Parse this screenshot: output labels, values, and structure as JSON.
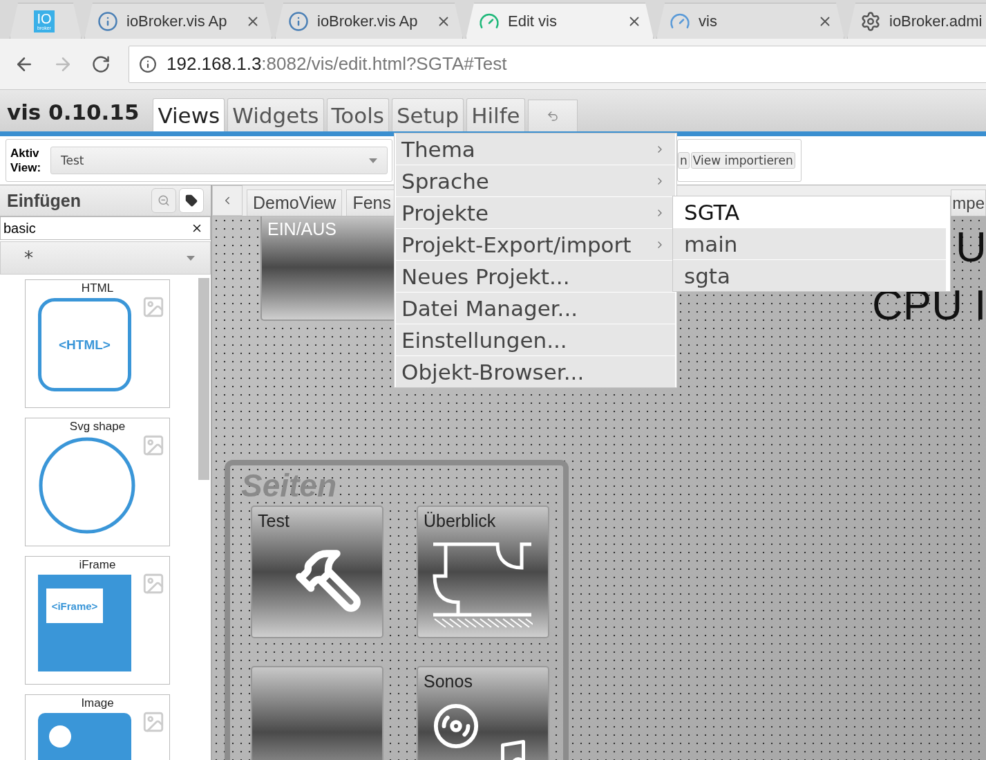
{
  "browser": {
    "tabs": [
      {
        "kind": "logo",
        "logo_text": "IO",
        "logo_subtext": "broker",
        "selected": false
      },
      {
        "kind": "info",
        "title": "ioBroker.vis Ap",
        "selected": false
      },
      {
        "kind": "info",
        "title": "ioBroker.vis Ap",
        "selected": false
      },
      {
        "kind": "dash",
        "title": "Edit vis",
        "selected": true
      },
      {
        "kind": "gauge",
        "title": "vis",
        "selected": false
      },
      {
        "kind": "gear",
        "title": "ioBroker.admi",
        "selected": false
      }
    ],
    "address": {
      "host": "192.168.1.3",
      "path": ":8082/vis/edit.html?SGTA#Test"
    }
  },
  "app": {
    "title": "vis 0.10.15",
    "tabs": [
      {
        "label": "Views",
        "selected": true
      },
      {
        "label": "Widgets",
        "selected": false
      },
      {
        "label": "Tools",
        "selected": false
      },
      {
        "label": "Setup",
        "selected": false
      },
      {
        "label": "Hilfe",
        "selected": false
      }
    ]
  },
  "toolbar": {
    "label": "Aktiv View:",
    "view_select": "Test",
    "buttons": [
      "n",
      "View importieren"
    ]
  },
  "palette": {
    "title": "Einfügen",
    "filter": "basic",
    "category": "*",
    "widgets": [
      {
        "title": "HTML",
        "kind": "html",
        "art_text": "<HTML>"
      },
      {
        "title": "Svg shape",
        "kind": "circle"
      },
      {
        "title": "iFrame",
        "kind": "iframe",
        "art_text": "<iFrame>"
      },
      {
        "title": "Image",
        "kind": "image"
      }
    ]
  },
  "view_tabs": [
    {
      "label": "DemoView"
    },
    {
      "label": "Fens"
    },
    {
      "label": "mpe"
    }
  ],
  "canvas": {
    "switch_title": "EIN/AUS",
    "group": {
      "title": "Seiten",
      "tiles": [
        {
          "kind": "hammer",
          "title": "Test"
        },
        {
          "kind": "building",
          "title": "Überblick"
        },
        {
          "kind": "blank"
        },
        {
          "kind": "sonos",
          "title": "Sonos"
        }
      ]
    },
    "labels": [
      "U",
      "CPU I"
    ]
  },
  "setup_menu": {
    "items": [
      {
        "label": "Thema",
        "submenu": true
      },
      {
        "label": "Sprache",
        "submenu": true
      },
      {
        "label": "Projekte",
        "submenu": true
      },
      {
        "label": "Projekt-Export/import",
        "submenu": true
      },
      {
        "label": "Neues Projekt...",
        "submenu": false
      },
      {
        "label": "Datei Manager...",
        "submenu": false
      },
      {
        "label": "Einstellungen...",
        "submenu": false
      },
      {
        "label": "Objekt-Browser...",
        "submenu": false
      }
    ]
  },
  "projects_submenu": {
    "items": [
      {
        "label": "SGTA",
        "selected": true
      },
      {
        "label": "main",
        "selected": false
      },
      {
        "label": "sgta",
        "selected": false
      }
    ]
  }
}
